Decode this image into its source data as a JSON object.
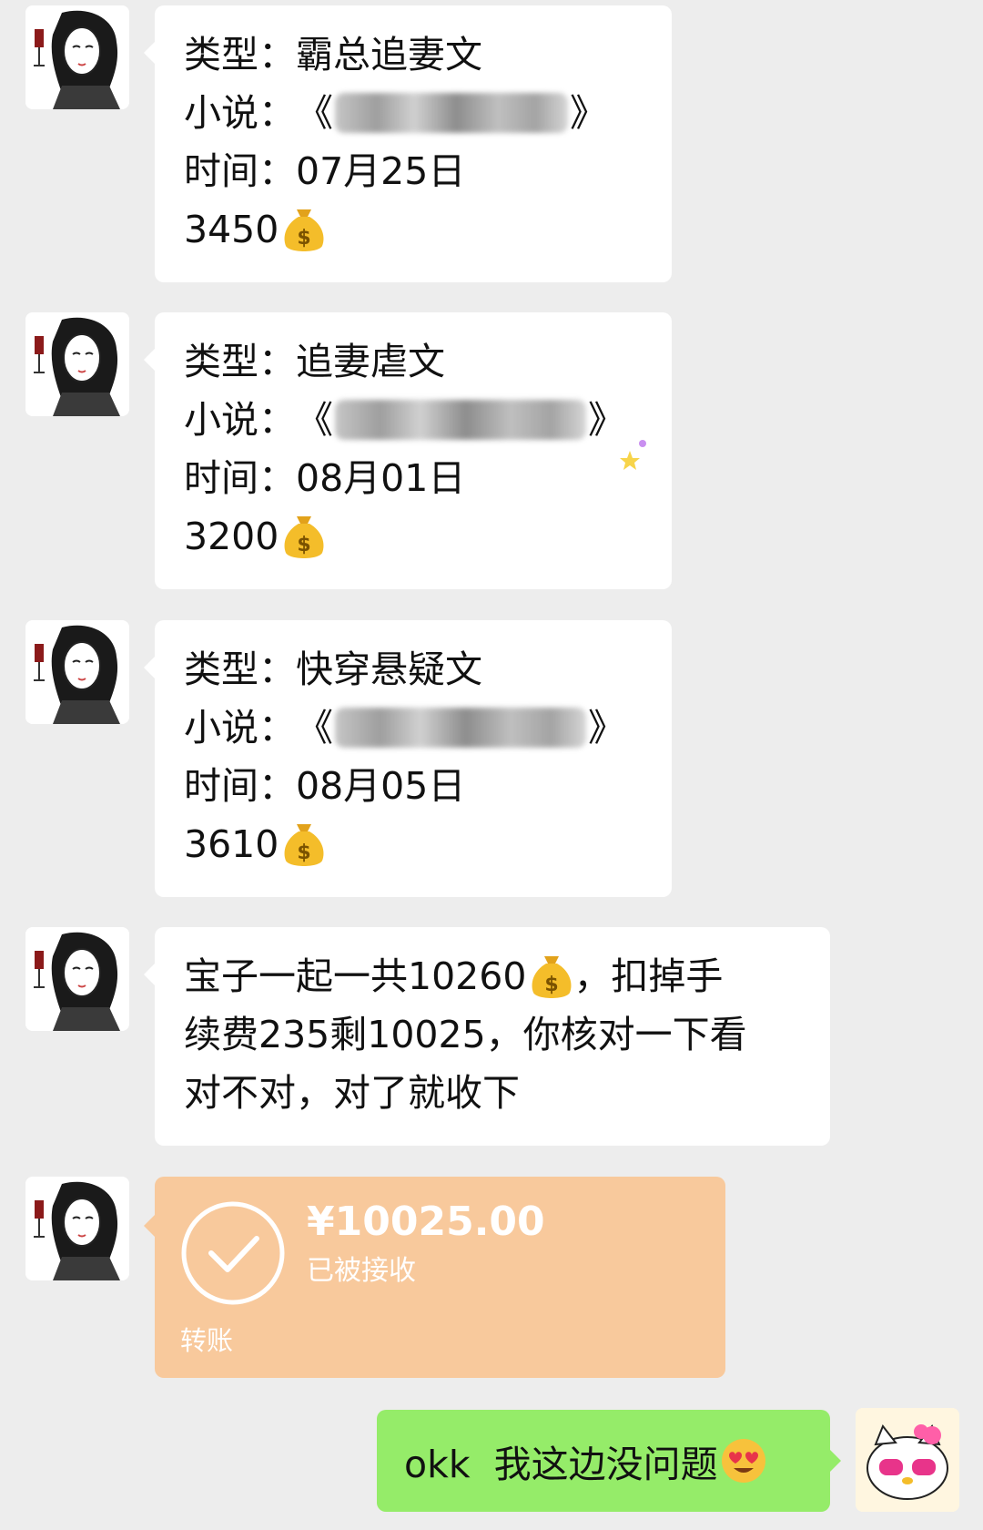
{
  "messages": [
    {
      "type_label": "类型：",
      "type_value": "霸总追妻文",
      "novel_label": "小说：",
      "novel_open": "《",
      "novel_close": "》",
      "time_label": "时间：",
      "time_value": "07月25日",
      "amount": "3450"
    },
    {
      "type_label": "类型：",
      "type_value": "追妻虐文",
      "novel_label": "小说：",
      "novel_open": "《",
      "novel_close": "》",
      "time_label": "时间：",
      "time_value": "08月01日",
      "amount": "3200"
    },
    {
      "type_label": "类型：",
      "type_value": "快穿悬疑文",
      "novel_label": "小说：",
      "novel_open": "《",
      "novel_close": "》",
      "time_label": "时间：",
      "time_value": "08月05日",
      "amount": "3610"
    }
  ],
  "summary": {
    "line1_pre": "宝子一起一共10260",
    "line1_post": "，扣掉手",
    "line2": "续费235剩10025，你核对一下看",
    "line3": "对不对，对了就收下"
  },
  "transfer": {
    "amount": "¥10025.00",
    "status": "已被接收",
    "type": "转账"
  },
  "outgoing": {
    "text": "okk  我这边没问题"
  },
  "icons": {
    "money_bag": "money-bag-emoji",
    "heart_eyes": "heart-eyes-emoji",
    "check": "check-circle-icon"
  },
  "colors": {
    "background": "#ededed",
    "incoming_bubble": "#ffffff",
    "transfer_bubble": "#f8c99c",
    "outgoing_bubble": "#95ec69"
  }
}
